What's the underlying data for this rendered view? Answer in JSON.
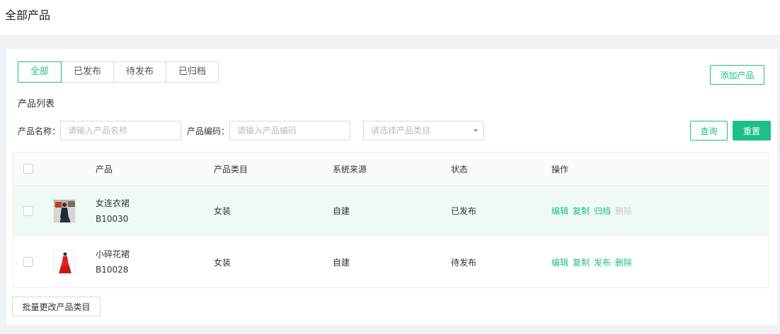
{
  "page": {
    "title": "全部产品"
  },
  "tabs": [
    {
      "label": "全部",
      "active": true
    },
    {
      "label": "已发布",
      "active": false
    },
    {
      "label": "待发布",
      "active": false
    },
    {
      "label": "已归档",
      "active": false
    }
  ],
  "add_button": "添加产品",
  "section_title": "产品列表",
  "filters": {
    "name_label": "产品名称：",
    "name_placeholder": "请输入产品名称",
    "code_label": "产品编码：",
    "code_placeholder": "请输入产品编码",
    "category_placeholder": "请选择产品类目"
  },
  "query_button": "查询",
  "reset_button": "重置",
  "table": {
    "columns": [
      "产品",
      "产品类目",
      "系统来源",
      "状态",
      "操作"
    ],
    "rows": [
      {
        "name": "女连衣裙",
        "code": "B10030",
        "category": "女装",
        "source": "自建",
        "status": "已发布",
        "ops": [
          {
            "label": "编辑",
            "enabled": true
          },
          {
            "label": "复制",
            "enabled": true
          },
          {
            "label": "归档",
            "enabled": true
          },
          {
            "label": "删除",
            "enabled": false
          }
        ]
      },
      {
        "name": "小碎花裙",
        "code": "B10028",
        "category": "女装",
        "source": "自建",
        "status": "待发布",
        "ops": [
          {
            "label": "编辑",
            "enabled": true
          },
          {
            "label": "复制",
            "enabled": true
          },
          {
            "label": "发布",
            "enabled": true
          },
          {
            "label": "删除",
            "enabled": true
          }
        ]
      }
    ]
  },
  "batch_button": "批量更改产品类目",
  "colors": {
    "accent": "#1fbf8c",
    "disabled": "#c7cbd0",
    "row_highlight": "#effaf6"
  }
}
